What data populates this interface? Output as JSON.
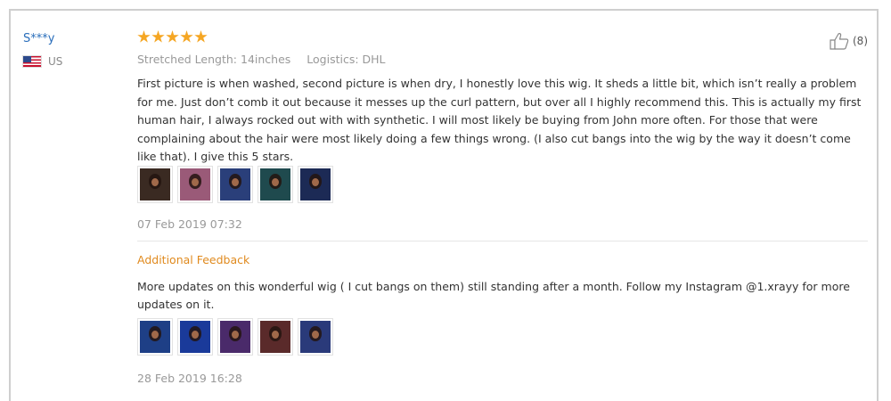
{
  "reviewer": {
    "name": "S***y",
    "country": "US",
    "flag_icon": "us-flag-icon"
  },
  "rating": {
    "stars": 5,
    "max": 5,
    "color": "#f5a623"
  },
  "meta": {
    "stretched_length": "Stretched Length: 14inches",
    "logistics": "Logistics: DHL"
  },
  "helpful": {
    "count": "(8)",
    "icon": "thumbs-up-icon"
  },
  "review": {
    "text": "First picture is when washed, second picture is when dry, I honestly love this wig. It sheds a little bit, which isn’t really a problem for me. Just don’t comb it out because it messes up the curl pattern, but over all I highly recommend this. This is actually my first human hair, I always rocked out with with synthetic. I will most likely be buying from John more often. For those that were complaining about the hair were most likely doing a few things wrong. (I also cut bangs into the wig by the way it doesn’t come like that). I give this 5 stars.",
    "date": "07 Feb 2019 07:32",
    "photos": [
      {
        "name": "photo-1",
        "bg": "#3a2a22"
      },
      {
        "name": "photo-2",
        "bg": "#9a5a78"
      },
      {
        "name": "photo-3",
        "bg": "#2a3f7a"
      },
      {
        "name": "photo-4",
        "bg": "#1f4a4e"
      },
      {
        "name": "photo-5",
        "bg": "#1c2a55"
      }
    ]
  },
  "additional_feedback": {
    "title": "Additional Feedback",
    "text": "More updates on this wonderful wig ( I cut bangs on them) still standing after a month. Follow my Instagram @1.xrayy for more updates on it.",
    "date": "28 Feb 2019 16:28",
    "photos": [
      {
        "name": "photo-1",
        "bg": "#1e3f86"
      },
      {
        "name": "photo-2",
        "bg": "#1a3a9a"
      },
      {
        "name": "photo-3",
        "bg": "#4a2a6a"
      },
      {
        "name": "photo-4",
        "bg": "#5a2a2a"
      },
      {
        "name": "photo-5",
        "bg": "#2a3a7a"
      }
    ]
  }
}
